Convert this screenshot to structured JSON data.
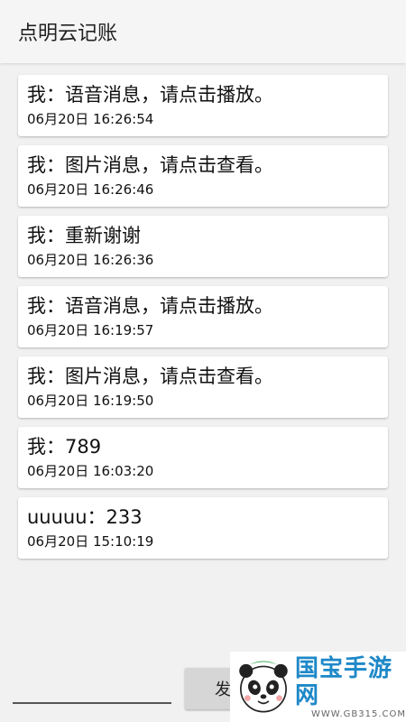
{
  "app": {
    "title": "点明云记账"
  },
  "messages": [
    {
      "text": "我：语音消息，请点击播放。",
      "time": "06月20日 16:26:54"
    },
    {
      "text": "我：图片消息，请点击查看。",
      "time": "06月20日 16:26:46"
    },
    {
      "text": "我：重新谢谢",
      "time": "06月20日 16:26:36"
    },
    {
      "text": "我：语音消息，请点击播放。",
      "time": "06月20日 16:19:57"
    },
    {
      "text": "我：图片消息，请点击查看。",
      "time": "06月20日 16:19:50"
    },
    {
      "text": "我：789",
      "time": "06月20日 16:03:20"
    },
    {
      "text": "uuuuu：233",
      "time": "06月20日 15:10:19"
    }
  ],
  "composer": {
    "input_value": "",
    "send_label": "发"
  },
  "watermark": {
    "title": "国宝手游网",
    "url": "WWW.GB315.COM"
  },
  "colors": {
    "appbar": "#f5f5f5",
    "background": "#f1f1f1",
    "card": "#ffffff",
    "send_button": "#d6d6d6",
    "watermark_blue": "#1e88c8",
    "watermark_green": "#2aa34a"
  }
}
